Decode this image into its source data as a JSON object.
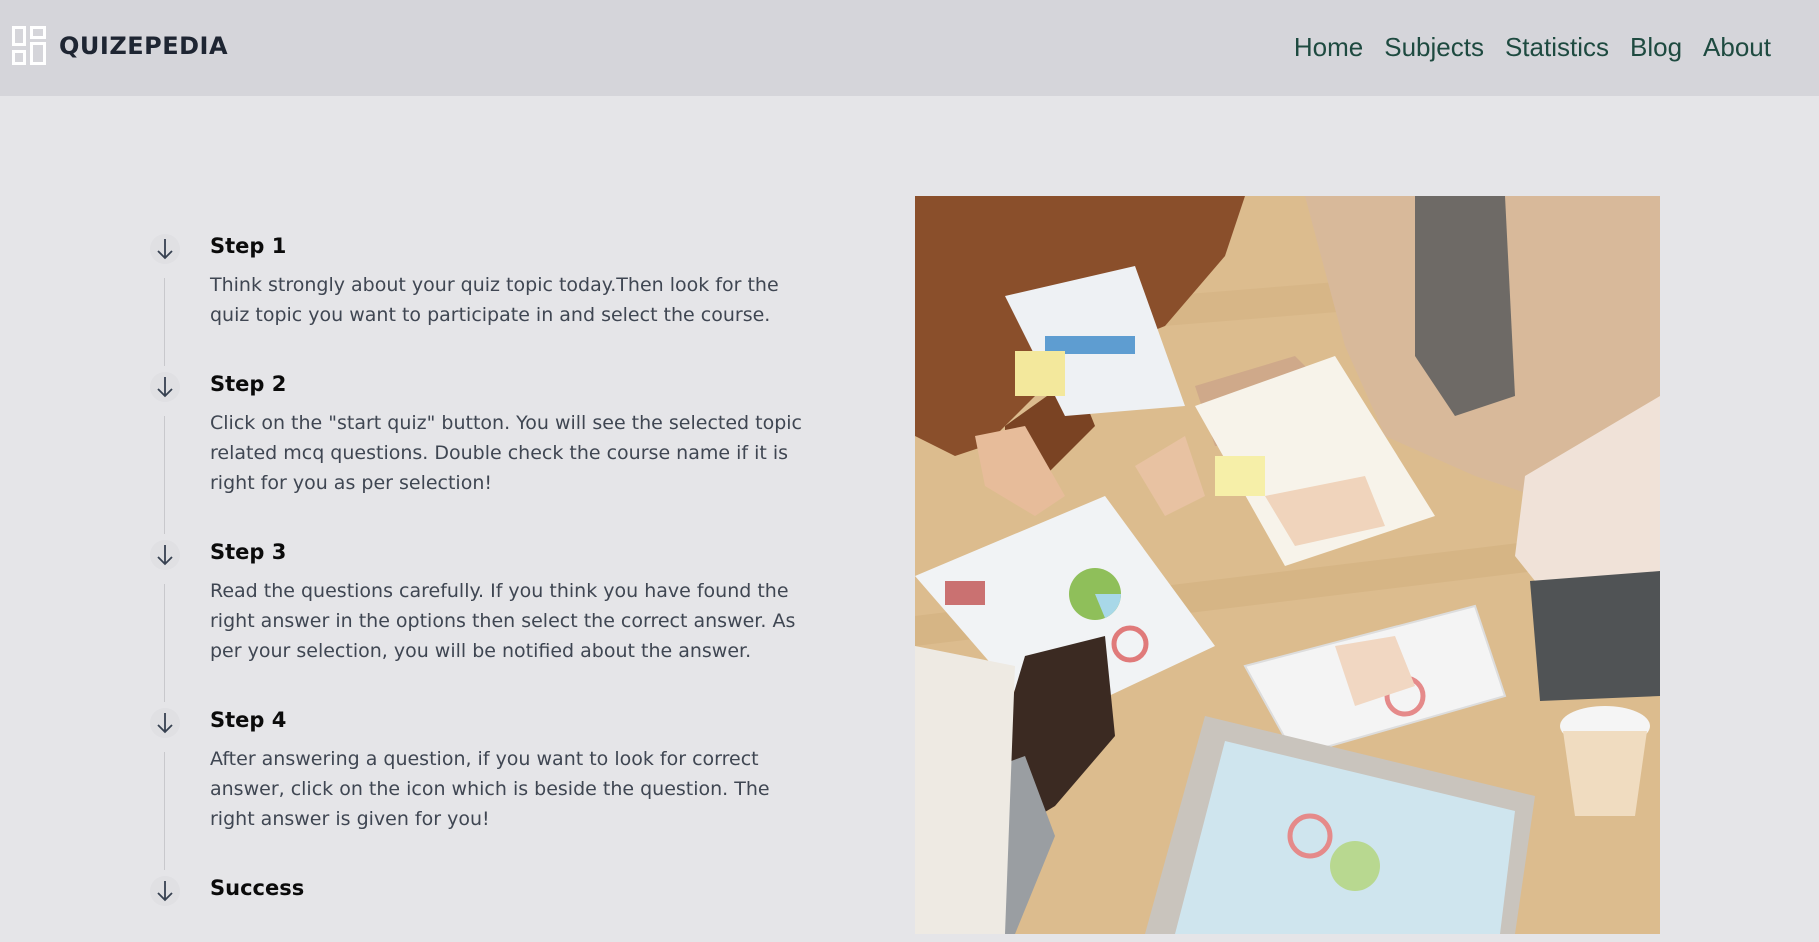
{
  "brand": {
    "name": "QUIZEPEDIA",
    "icon": "dashboard-grid-icon"
  },
  "nav": {
    "items": [
      {
        "label": "Home"
      },
      {
        "label": "Subjects"
      },
      {
        "label": "Statistics"
      },
      {
        "label": "Blog"
      },
      {
        "label": "About"
      }
    ]
  },
  "steps": [
    {
      "title": "Step 1",
      "description": "Think strongly about your quiz topic today.Then look for the quiz topic you want to participate in and select the course.",
      "icon": "arrow-down-icon"
    },
    {
      "title": "Step 2",
      "description": "Click on the \"start quiz\" button. You will see the selected topic related mcq questions. Double check the course name if it is right for you as per selection!",
      "icon": "arrow-down-icon"
    },
    {
      "title": "Step 3",
      "description": "Read the questions carefully. If you think you have found the right answer in the options then select the correct answer. As per your selection, you will be notified about the answer.",
      "icon": "arrow-down-icon"
    },
    {
      "title": "Step 4",
      "description": "After answering a question, if you want to look for correct answer, click on the icon which is beside the question. The right answer is given for you!",
      "icon": "arrow-down-icon"
    },
    {
      "title": "Success",
      "description": "",
      "icon": "arrow-down-icon"
    }
  ],
  "colors": {
    "navbar_bg": "#d5d5da",
    "page_bg": "#e5e5e8",
    "nav_link": "#1e4a40",
    "brand_text": "#1e2532"
  }
}
